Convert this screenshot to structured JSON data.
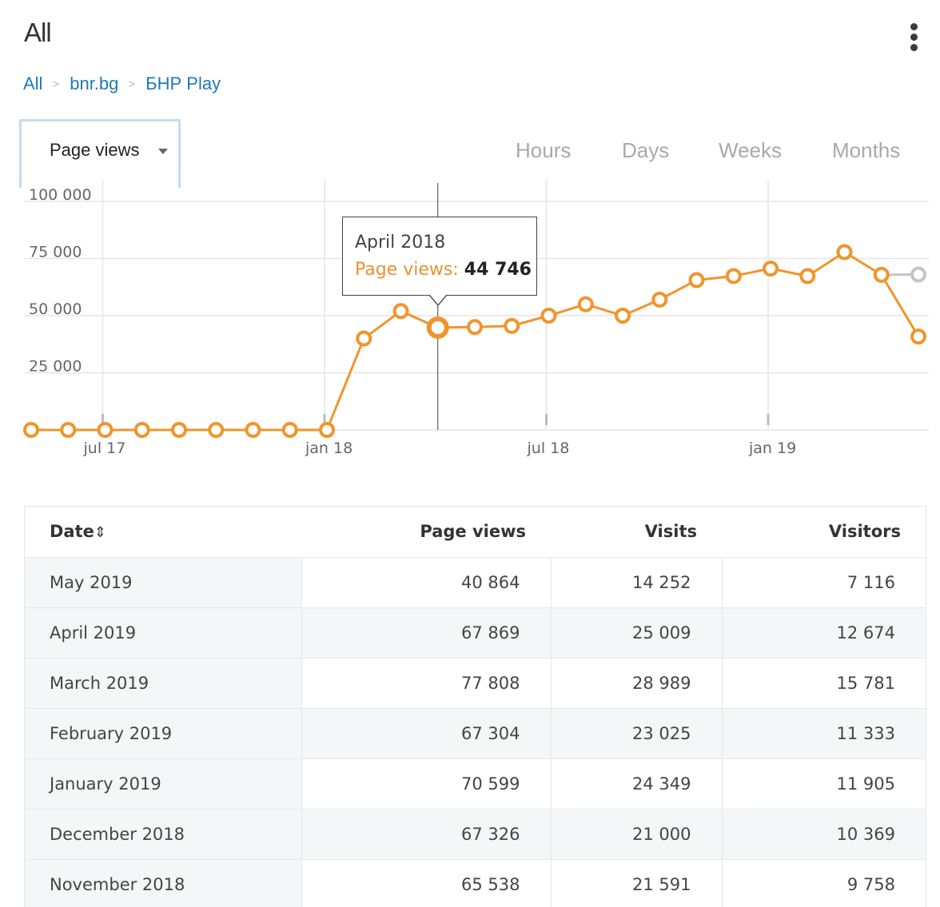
{
  "header": {
    "title": "All",
    "menu_icon": "more-vertical-icon"
  },
  "breadcrumb": [
    {
      "label": "All"
    },
    {
      "label": "bnr.bg"
    },
    {
      "label": "БНР Play"
    }
  ],
  "breadcrumb_separator": ">",
  "metric_select": {
    "label": "Page views",
    "icon": "caret-down-icon"
  },
  "periods": [
    "Hours",
    "Days",
    "Weeks",
    "Months"
  ],
  "tooltip": {
    "date": "April 2018",
    "label": "Page views:",
    "value": "44 746"
  },
  "colors": {
    "line": "#f0952c",
    "projection": "#c4c4c4",
    "link": "#1f7ab8",
    "grid": "#e6e6e6"
  },
  "chart_data": {
    "type": "line",
    "series": [
      {
        "name": "Page views",
        "points": [
          {
            "x": "2017-05",
            "y": 0
          },
          {
            "x": "2017-06",
            "y": 0
          },
          {
            "x": "2017-07",
            "y": 0
          },
          {
            "x": "2017-08",
            "y": 0
          },
          {
            "x": "2017-09",
            "y": 0
          },
          {
            "x": "2017-10",
            "y": 0
          },
          {
            "x": "2017-11",
            "y": 0
          },
          {
            "x": "2017-12",
            "y": 0
          },
          {
            "x": "2018-01",
            "y": 0
          },
          {
            "x": "2018-02",
            "y": 40000
          },
          {
            "x": "2018-03",
            "y": 52000
          },
          {
            "x": "2018-04",
            "y": 44746
          },
          {
            "x": "2018-05",
            "y": 45000
          },
          {
            "x": "2018-06",
            "y": 45500
          },
          {
            "x": "2018-07",
            "y": 50000
          },
          {
            "x": "2018-08",
            "y": 55000
          },
          {
            "x": "2018-09",
            "y": 50000
          },
          {
            "x": "2018-10",
            "y": 57000
          },
          {
            "x": "2018-11",
            "y": 65538
          },
          {
            "x": "2018-12",
            "y": 67326
          },
          {
            "x": "2019-01",
            "y": 70599
          },
          {
            "x": "2019-02",
            "y": 67304
          },
          {
            "x": "2019-03",
            "y": 77808
          },
          {
            "x": "2019-04",
            "y": 67869
          },
          {
            "x": "2019-05",
            "y": 40864
          }
        ]
      }
    ],
    "projection": {
      "x": "2019-05",
      "y": 68000
    },
    "highlighted": "2018-04",
    "x_ticks": [
      {
        "x": "2017-07",
        "label": "jul 17"
      },
      {
        "x": "2018-01",
        "label": "jan 18"
      },
      {
        "x": "2018-07",
        "label": "jul 18"
      },
      {
        "x": "2019-01",
        "label": "jan 19"
      }
    ],
    "y_ticks": [
      {
        "value": 100000,
        "label": "100 000"
      },
      {
        "value": 75000,
        "label": "75 000"
      },
      {
        "value": 50000,
        "label": "50 000"
      },
      {
        "value": 25000,
        "label": "25 000"
      }
    ],
    "ylim": [
      0,
      100000
    ],
    "grid": true
  },
  "table": {
    "columns": [
      "Date",
      "Page views",
      "Visits",
      "Visitors"
    ],
    "sort_icon": "sort-icon",
    "rows": [
      [
        "May 2019",
        "40 864",
        "14 252",
        "7 116"
      ],
      [
        "April 2019",
        "67 869",
        "25 009",
        "12 674"
      ],
      [
        "March 2019",
        "77 808",
        "28 989",
        "15 781"
      ],
      [
        "February 2019",
        "67 304",
        "23 025",
        "11 333"
      ],
      [
        "January 2019",
        "70 599",
        "24 349",
        "11 905"
      ],
      [
        "December 2018",
        "67 326",
        "21 000",
        "10 369"
      ],
      [
        "November 2018",
        "65 538",
        "21 591",
        "9 758"
      ]
    ]
  }
}
